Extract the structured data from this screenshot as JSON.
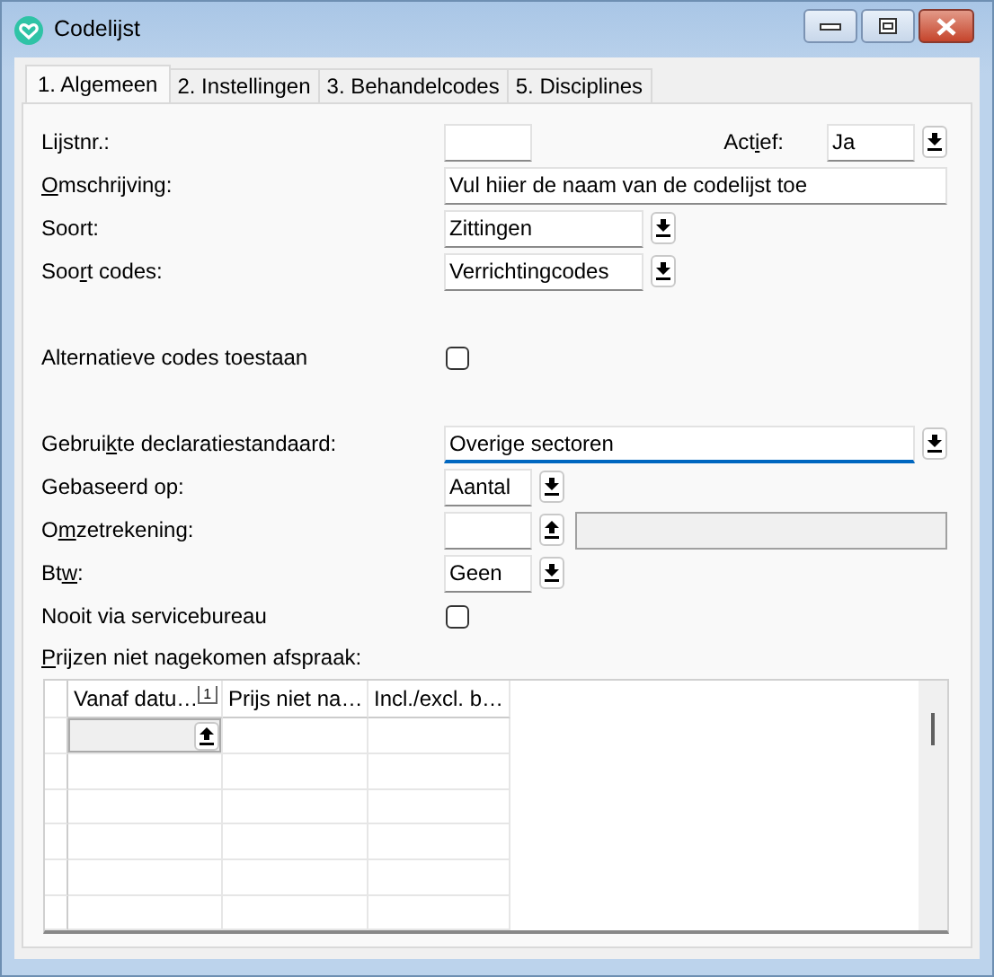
{
  "window": {
    "title": "Codelijst"
  },
  "tabs": [
    {
      "label": "1. Algemeen",
      "selected": true
    },
    {
      "label": "2. Instellingen",
      "selected": false
    },
    {
      "label": "3. Behandelcodes",
      "selected": false
    },
    {
      "label": "5. Disciplines",
      "selected": false
    }
  ],
  "sections": [
    [
      {
        "label": {
          "after": "Lijstnr.:"
        },
        "controls": [
          {
            "kind": "text-short"
          },
          {
            "kind": "label",
            "label": {
              "before": "Act",
              "key": "i",
              "after": "ef:"
            }
          },
          {
            "kind": "dropdown-short",
            "value": "Ja"
          }
        ]
      },
      {
        "label": {
          "key": "O",
          "after": "mschrijving:"
        },
        "controls": [
          {
            "kind": "text-wide",
            "value": "Vul hiier de naam van de codelijst toe"
          }
        ]
      },
      {
        "label": {
          "after": "Soort:"
        },
        "controls": [
          {
            "kind": "dropdown-medium",
            "value": "Zittingen"
          }
        ]
      },
      {
        "label": {
          "before": "Soo",
          "key": "r",
          "after": "t codes:"
        },
        "controls": [
          {
            "kind": "dropdown-medium",
            "value": "Verrichtingcodes"
          }
        ]
      }
    ],
    [
      {
        "label": {
          "after": "Alternatieve codes toestaan"
        },
        "controls": [
          {
            "kind": "checkbox",
            "checked": false
          }
        ]
      }
    ],
    [
      {
        "label": {
          "before": "Gebrui",
          "key": "k",
          "after": "te declaratiestandaard:"
        },
        "controls": [
          {
            "kind": "dropdown-wide",
            "value": "Overige sectoren",
            "focused": true
          }
        ]
      },
      {
        "label": {
          "after": "Gebaseerd op:"
        },
        "controls": [
          {
            "kind": "dropdown-short",
            "value": "Aantal"
          }
        ]
      },
      {
        "label": {
          "before": "O",
          "key": "m",
          "after": "zetrekening:"
        },
        "controls": [
          {
            "kind": "spinner-short"
          },
          {
            "kind": "readonly-wide"
          }
        ]
      },
      {
        "label": {
          "before": "Bt",
          "key": "w",
          "after": ":"
        },
        "controls": [
          {
            "kind": "dropdown-short",
            "value": "Geen"
          }
        ]
      },
      {
        "label": {
          "after": "Nooit via servicebureau"
        },
        "controls": [
          {
            "kind": "checkbox",
            "checked": false
          }
        ]
      }
    ]
  ],
  "grid": {
    "label": {
      "key": "P",
      "after": "rijzen niet nagekomen afspraak:"
    },
    "columns": [
      {
        "title": "Vanaf datu…",
        "sort_rank": "1"
      },
      {
        "title": "Prijs niet na…"
      },
      {
        "title": "Incl./excl. b…"
      }
    ],
    "rows": [
      {
        "editing": true
      },
      {
        "editing": false
      },
      {
        "editing": false
      },
      {
        "editing": false
      },
      {
        "editing": false
      },
      {
        "editing": false
      }
    ]
  }
}
